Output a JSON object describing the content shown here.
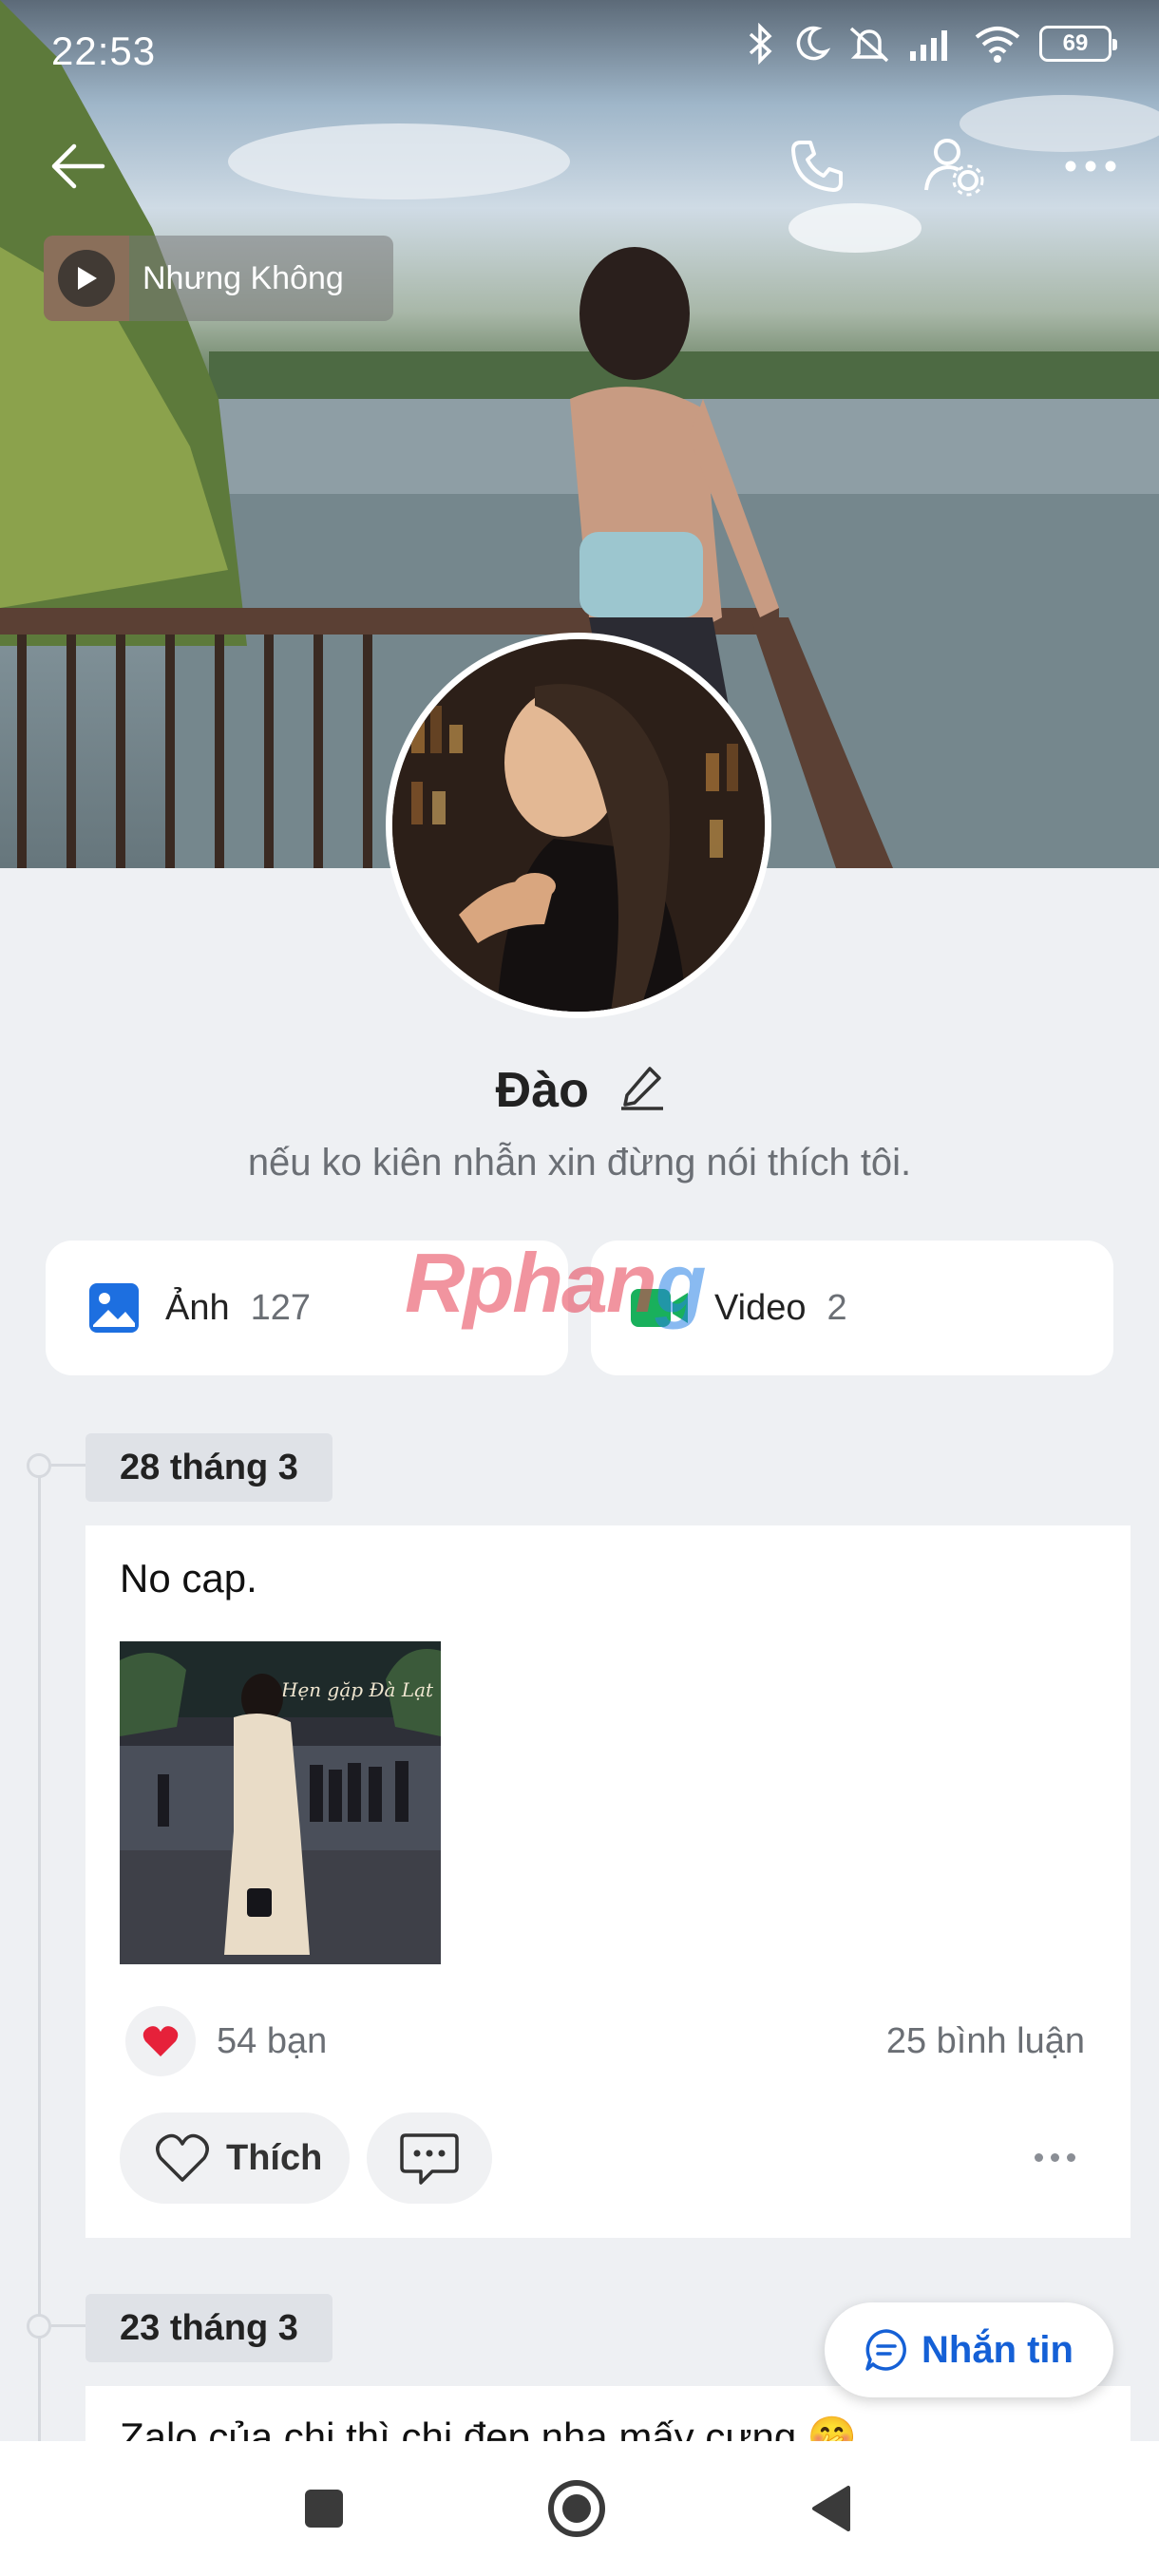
{
  "status_bar": {
    "time": "22:53",
    "battery": "69",
    "icons": [
      "bluetooth-icon",
      "moon-icon",
      "mute-icon",
      "signal-icon",
      "wifi-icon",
      "battery-icon"
    ]
  },
  "top_bar": {
    "icons": [
      "back-arrow-icon",
      "phone-icon",
      "user-settings-icon",
      "more-icon"
    ]
  },
  "music": {
    "title": "Nhưng Không"
  },
  "profile": {
    "name": "Đào",
    "status": "nếu ko kiên nhẫn xin đừng nói thích tôi."
  },
  "media": {
    "photos_label": "Ảnh",
    "photos_count": "127",
    "videos_label": "Video",
    "videos_count": "2"
  },
  "watermark": {
    "part1": "Rphan",
    "part2": "g"
  },
  "feed": [
    {
      "date": "28 tháng 3",
      "text": "No cap.",
      "reaction_count": "54 bạn",
      "comment_count": "25 bình luận",
      "like_label": "Thích",
      "photo_sign": "Hẹn gặp Đà Lạt"
    },
    {
      "date": "23 tháng 3",
      "text": "Zalo của chị thì chị đẹp nha mấy cưng 🤭"
    }
  ],
  "message_button": {
    "label": "Nhắn tin"
  },
  "colors": {
    "accent": "#1560d6",
    "background": "#eef0f3",
    "heart": "#e6213a"
  }
}
